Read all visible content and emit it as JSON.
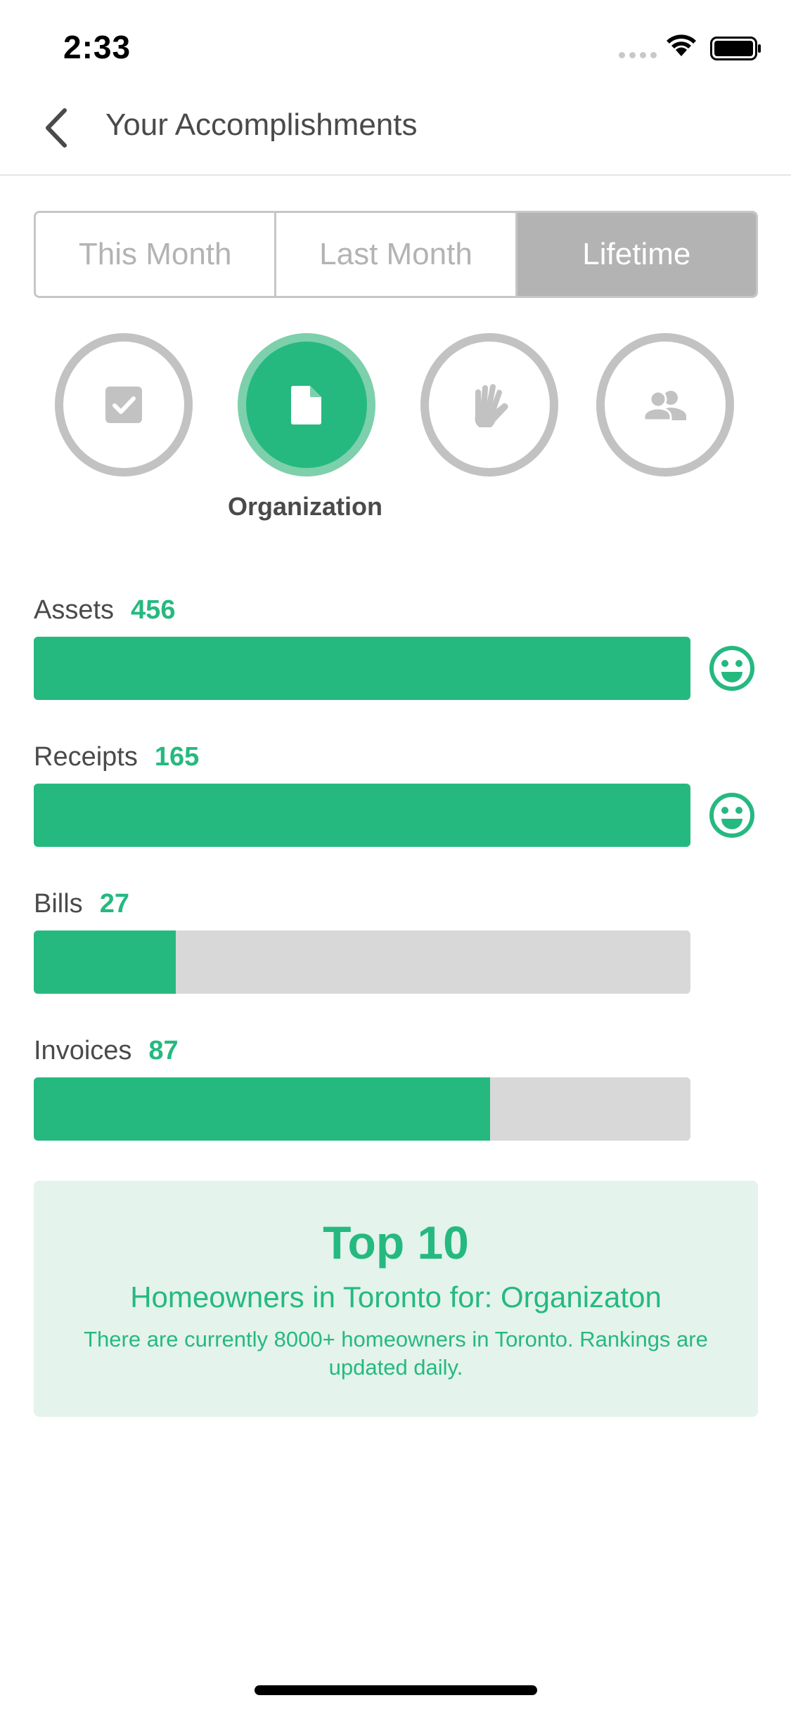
{
  "status_bar": {
    "time": "2:33"
  },
  "nav": {
    "title": "Your Accomplishments",
    "back_icon": "chevron-left-icon"
  },
  "period_tabs": [
    {
      "label": "This Month",
      "active": false
    },
    {
      "label": "Last Month",
      "active": false
    },
    {
      "label": "Lifetime",
      "active": true
    }
  ],
  "categories": [
    {
      "icon": "checkbox-icon",
      "active": false
    },
    {
      "icon": "document-icon",
      "active": true
    },
    {
      "icon": "hand-icon",
      "active": false
    },
    {
      "icon": "people-icon",
      "active": false
    }
  ],
  "selected_category_label": "Organization",
  "stats": [
    {
      "label": "Assets",
      "value": "456",
      "progress": 1.0,
      "smiley": true
    },
    {
      "label": "Receipts",
      "value": "165",
      "progress": 1.0,
      "smiley": true
    },
    {
      "label": "Bills",
      "value": "27",
      "progress": 0.216,
      "smiley": false
    },
    {
      "label": "Invoices",
      "value": "87",
      "progress": 0.695,
      "smiley": false
    }
  ],
  "summary": {
    "title": "Top 10",
    "subtitle": "Homeowners in Toronto for: Organizaton",
    "note": "There are currently 8000+ homeowners in Toronto. Rankings are updated daily."
  },
  "colors": {
    "accent": "#25b980",
    "accent_light": "#7dd0ab",
    "card_bg": "#e4f3ec",
    "inactive_gray": "#c2c2c2",
    "track_gray": "#d8d8d8"
  }
}
